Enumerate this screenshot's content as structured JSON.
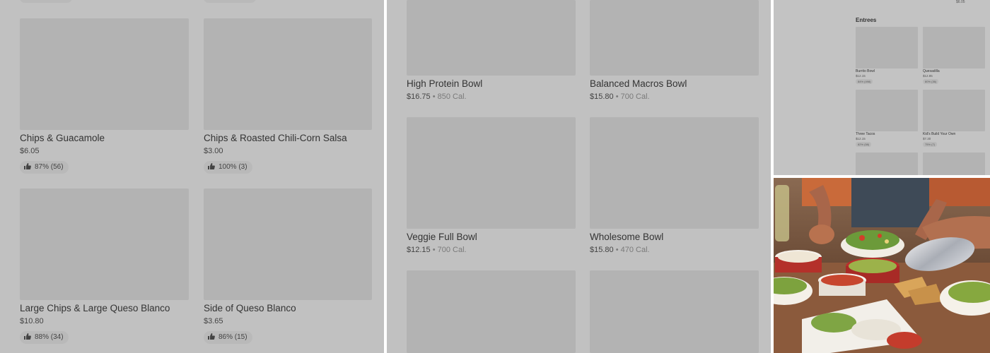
{
  "left_panel": {
    "items": [
      {
        "name": "Chips & Guacamole",
        "price": "$6.05",
        "rating": "87% (56)"
      },
      {
        "name": "Chips & Roasted Chili-Corn Salsa",
        "price": "$3.00",
        "rating": "100% (3)"
      },
      {
        "name": "Large Chips & Large Queso Blanco",
        "price": "$10.80",
        "rating": "88% (34)"
      },
      {
        "name": "Side of Queso Blanco",
        "price": "$3.65",
        "rating": "86% (15)"
      }
    ]
  },
  "mid_panel": {
    "items": [
      {
        "name": "High Protein Bowl",
        "price": "$16.75",
        "calories": "850 Cal."
      },
      {
        "name": "Balanced Macros Bowl",
        "price": "$15.80",
        "calories": "700 Cal."
      },
      {
        "name": "Veggie Full Bowl",
        "price": "$12.15",
        "calories": "700 Cal."
      },
      {
        "name": "Wholesome Bowl",
        "price": "$15.80",
        "calories": "470 Cal."
      }
    ],
    "separator": "•"
  },
  "right_top_panel": {
    "top_price": "$6.05",
    "section_title": "Entrees",
    "items": [
      {
        "name": "Burrito Bowl",
        "price": "$12.15",
        "rating": "84% (498)"
      },
      {
        "name": "Quesadilla",
        "price": "$12.85",
        "rating": "80% (36)"
      },
      {
        "name": "Three Tacos",
        "price": "$12.15",
        "rating": "82% (58)"
      },
      {
        "name": "Kid's Build Your Own",
        "price": "$7.30",
        "rating": "75% (7)"
      }
    ]
  },
  "right_bottom_panel": {
    "photo": "food-photo"
  },
  "colors": {
    "overlay_gray": "#c1c1c1",
    "placeholder_gray": "#b3b3b3",
    "divider": "#ffffff"
  }
}
